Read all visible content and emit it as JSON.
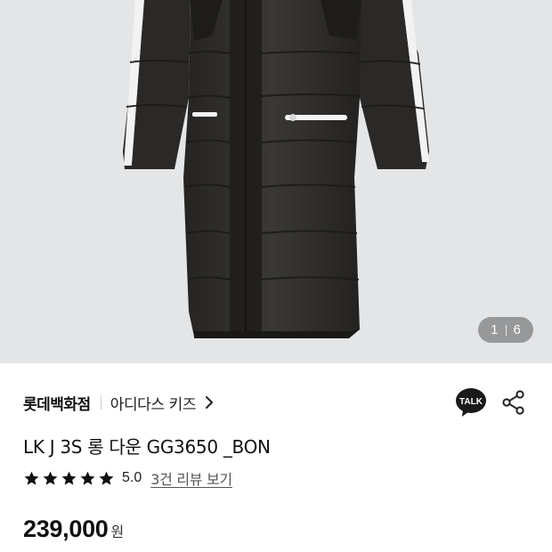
{
  "product_image": {
    "alt": "",
    "pager": {
      "current": "1",
      "total": "6"
    }
  },
  "store": {
    "name": "롯데백화점",
    "brand": "아디다스 키즈"
  },
  "actions": {
    "talk_label": "TALK",
    "talk_icon": "kakao-talk-icon",
    "share_icon": "share-icon"
  },
  "product": {
    "title": "LK J 3S 롱 다운 GG3650 _BON",
    "rating": "5.0",
    "star_count": 5,
    "review_link": "3건 리뷰 보기",
    "price": "239,000",
    "currency": "원"
  },
  "colors": {
    "image_bg": "#e3e5e7",
    "jacket": "#2f2d2b",
    "text": "#111111",
    "link": "#555555"
  }
}
